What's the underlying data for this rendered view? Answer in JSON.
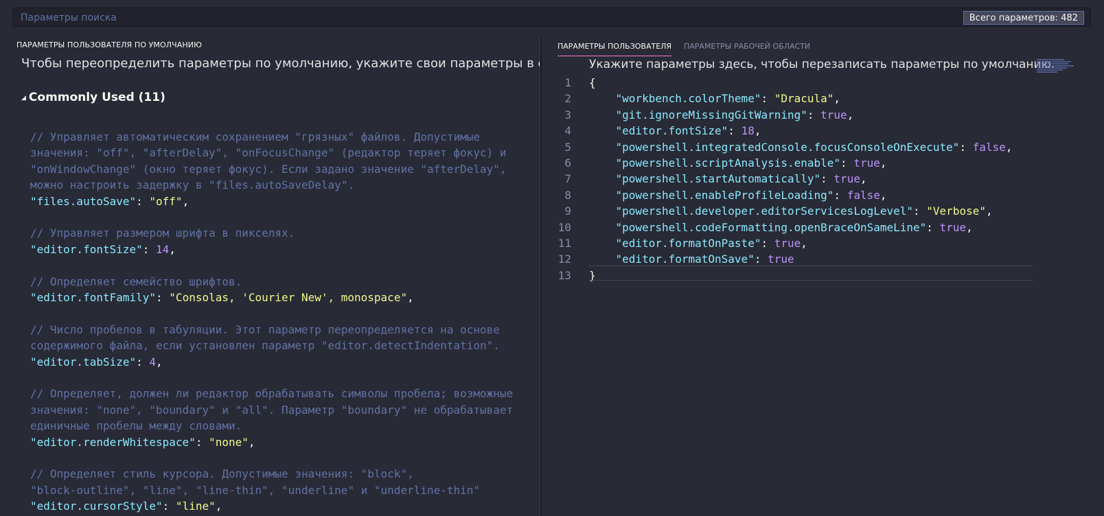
{
  "search": {
    "placeholder": "Параметры поиска",
    "count_label": "Всего параметров: 482"
  },
  "left": {
    "title": "ПАРАМЕТРЫ ПОЛЬЗОВАТЕЛЯ ПО УМОЛЧАНИЮ",
    "hint": "Чтобы переопределить параметры по умолчанию, укажите свои параметры в области спра",
    "group_header": "Commonly Used (11)",
    "settings": [
      {
        "comment": [
          "// Управляет автоматическим сохранением \"грязных\" файлов. Допустимые",
          "значения: \"off\", \"afterDelay\", \"onFocusChange\" (редактор теряет фокус) и",
          "\"onWindowChange\" (окно теряет фокус). Если задано значение \"afterDelay\",",
          "можно настроить задержку в \"files.autoSaveDelay\"."
        ],
        "key": "\"files.autoSave\"",
        "value": "\"off\"",
        "value_type": "string"
      },
      {
        "comment": [
          "// Управляет размером шрифта в пикселях."
        ],
        "key": "\"editor.fontSize\"",
        "value": "14",
        "value_type": "number"
      },
      {
        "comment": [
          "// Определяет семейство шрифтов."
        ],
        "key": "\"editor.fontFamily\"",
        "value": "\"Consolas, 'Courier New', monospace\"",
        "value_type": "string"
      },
      {
        "comment": [
          "// Число пробелов в табуляции. Этот параметр переопределяется на основе",
          "содержимого файла, если установлен параметр \"editor.detectIndentation\"."
        ],
        "key": "\"editor.tabSize\"",
        "value": "4",
        "value_type": "number"
      },
      {
        "comment": [
          "// Определяет, должен ли редактор обрабатывать символы пробела; возможные",
          "значения: \"none\", \"boundary\" и \"all\". Параметр \"boundary\" не обрабатывает",
          "единичные пробелы между словами."
        ],
        "key": "\"editor.renderWhitespace\"",
        "value": "\"none\"",
        "value_type": "string"
      },
      {
        "comment": [
          "// Определяет стиль курсора. Допустимые значения: \"block\",",
          "\"block-outline\", \"line\", \"line-thin\", \"underline\" и \"underline-thin\""
        ],
        "key": "\"editor.cursorStyle\"",
        "value": "\"line\"",
        "value_type": "string"
      }
    ]
  },
  "right": {
    "tabs": [
      {
        "label": "ПАРАМЕТРЫ ПОЛЬЗОВАТЕЛЯ",
        "active": true
      },
      {
        "label": "ПАРАМЕТРЫ РАБОЧЕЙ ОБЛАСТИ",
        "active": false
      }
    ],
    "hint": "Укажите параметры здесь, чтобы перезаписать параметры по умолчанию.",
    "line_numbers": [
      "1",
      "2",
      "3",
      "4",
      "5",
      "6",
      "7",
      "8",
      "9",
      "10",
      "11",
      "12",
      "13"
    ],
    "open_brace": "{",
    "close_brace": "}",
    "entries": [
      {
        "key": "\"workbench.colorTheme\"",
        "value": "\"Dracula\"",
        "value_type": "string"
      },
      {
        "key": "\"git.ignoreMissingGitWarning\"",
        "value": "true",
        "value_type": "bool"
      },
      {
        "key": "\"editor.fontSize\"",
        "value": "18",
        "value_type": "number"
      },
      {
        "key": "\"powershell.integratedConsole.focusConsoleOnExecute\"",
        "value": "false",
        "value_type": "bool"
      },
      {
        "key": "\"powershell.scriptAnalysis.enable\"",
        "value": "true",
        "value_type": "bool"
      },
      {
        "key": "\"powershell.startAutomatically\"",
        "value": "true",
        "value_type": "bool"
      },
      {
        "key": "\"powershell.enableProfileLoading\"",
        "value": "false",
        "value_type": "bool"
      },
      {
        "key": "\"powershell.developer.editorServicesLogLevel\"",
        "value": "\"Verbose\"",
        "value_type": "string"
      },
      {
        "key": "\"powershell.codeFormatting.openBraceOnSameLine\"",
        "value": "true",
        "value_type": "bool"
      },
      {
        "key": "\"editor.formatOnPaste\"",
        "value": "true",
        "value_type": "bool"
      },
      {
        "key": "\"editor.formatOnSave\"",
        "value": "true",
        "value_type": "bool"
      }
    ]
  },
  "colors": {
    "background": "#282a36",
    "comment": "#6272a4",
    "key": "#8be9fd",
    "string": "#f1fa8c",
    "number_bool": "#bd93f9",
    "active_tab_underline": "#ff79c6"
  }
}
